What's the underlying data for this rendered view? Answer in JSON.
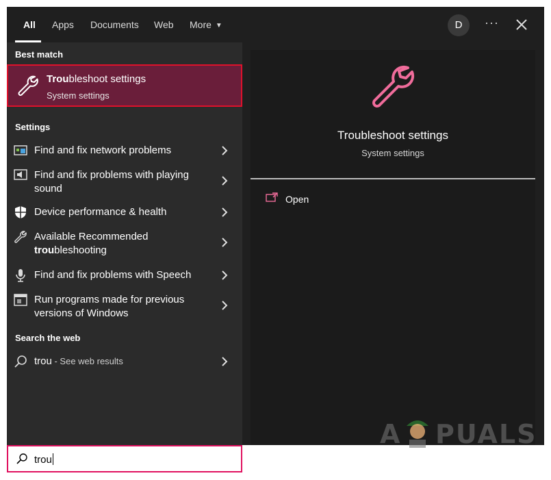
{
  "tabs": [
    {
      "label": "All"
    },
    {
      "label": "Apps"
    },
    {
      "label": "Documents"
    },
    {
      "label": "Web"
    },
    {
      "label": "More"
    }
  ],
  "header": {
    "avatar_letter": "D",
    "options_icon": "ellipsis-icon",
    "close_icon": "close-icon"
  },
  "sections": {
    "best_match": "Best match",
    "settings": "Settings",
    "web": "Search the web"
  },
  "best_match": {
    "title_bold": "Trou",
    "title_rest": "bleshoot settings",
    "subtitle": "System settings",
    "icon": "wrench-icon"
  },
  "settings_items": [
    {
      "line1": "Find and fix network problems",
      "line2": "",
      "icon": "network-icon"
    },
    {
      "line1": "Find and fix problems with playing",
      "line2": "sound",
      "icon": "speaker-icon"
    },
    {
      "line1": "Device performance & health",
      "line2": "",
      "icon": "shield-icon"
    },
    {
      "line1": "Available Recommended",
      "line2_bold": "trou",
      "line2_rest": "bleshooting",
      "icon": "wrench-icon"
    },
    {
      "line1": "Find and fix problems with Speech",
      "line2": "",
      "icon": "microphone-icon"
    },
    {
      "line1": "Run programs made for previous",
      "line2": "versions of Windows",
      "icon": "app-window-icon"
    }
  ],
  "web_result": {
    "query": "trou",
    "suffix": " - See web results",
    "icon": "search-icon"
  },
  "preview": {
    "title": "Troubleshoot settings",
    "subtitle": "System settings",
    "action": "Open",
    "icon": "wrench-icon"
  },
  "search": {
    "value": "trou"
  },
  "watermark": {
    "left": "A",
    "right": "PUALS"
  },
  "colors": {
    "accent_pink": "#f06c9b",
    "best_match_bg": "#6a1e3a",
    "highlight_border": "#e0112b",
    "searchbox_border": "#e0115f"
  }
}
